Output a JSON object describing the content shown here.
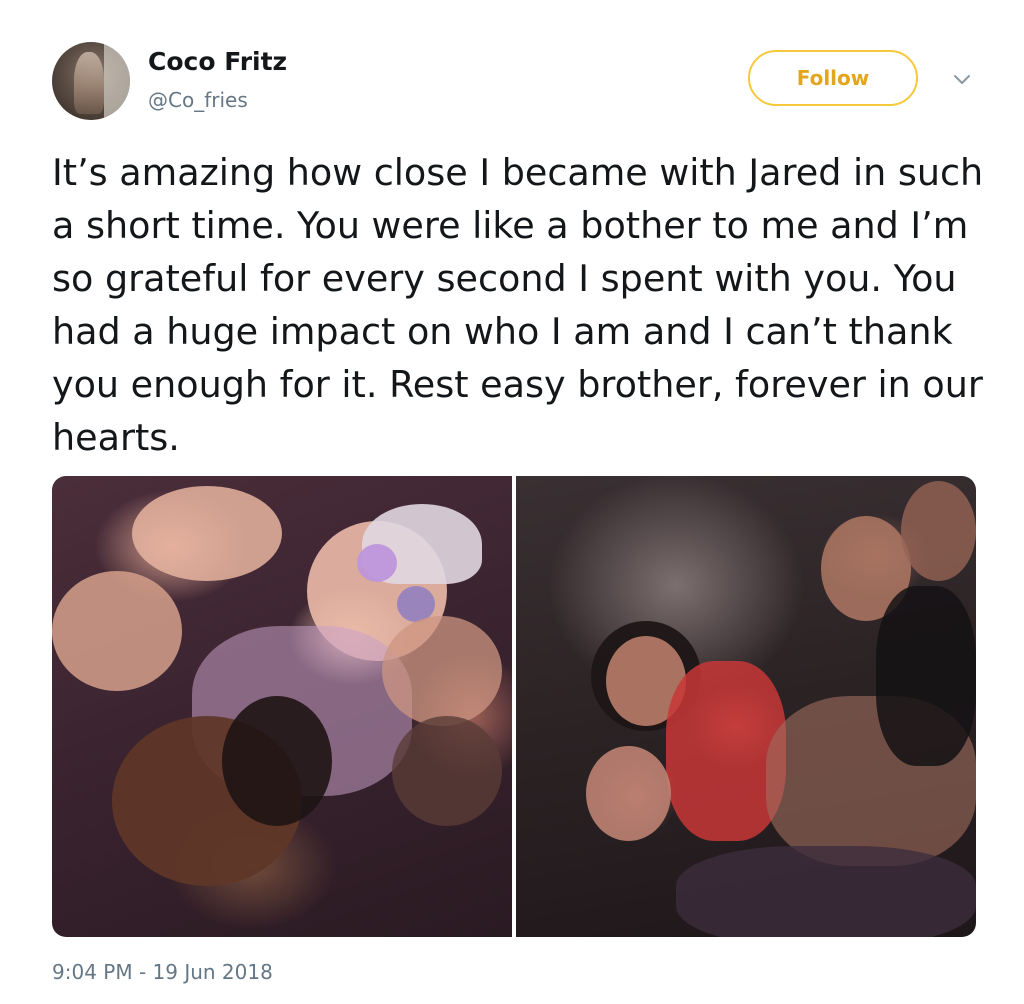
{
  "author": {
    "display_name": "Coco Fritz",
    "handle": "@Co_fries",
    "avatar_icon": "profile-photo"
  },
  "actions": {
    "follow_label": "Follow",
    "menu_icon": "chevron-down-icon"
  },
  "colors": {
    "follow_accent": "#f5c93b",
    "follow_text": "#e3a51c",
    "secondary_text": "#657786",
    "primary_text": "#14171a"
  },
  "tweet": {
    "text": "It’s amazing how close I became with Jared in such a short time. You were like a bother to me and I’m so grateful for every second I spent with you. You had a huge impact on who I am and I can’t thank you enough for it. Rest easy brother, forever in our hearts.",
    "timestamp": "9:04 PM - 19 Jun 2018"
  },
  "media": {
    "photos": [
      {
        "subject": "group-selfie-photo"
      },
      {
        "subject": "group-photo-on-couch"
      }
    ]
  }
}
